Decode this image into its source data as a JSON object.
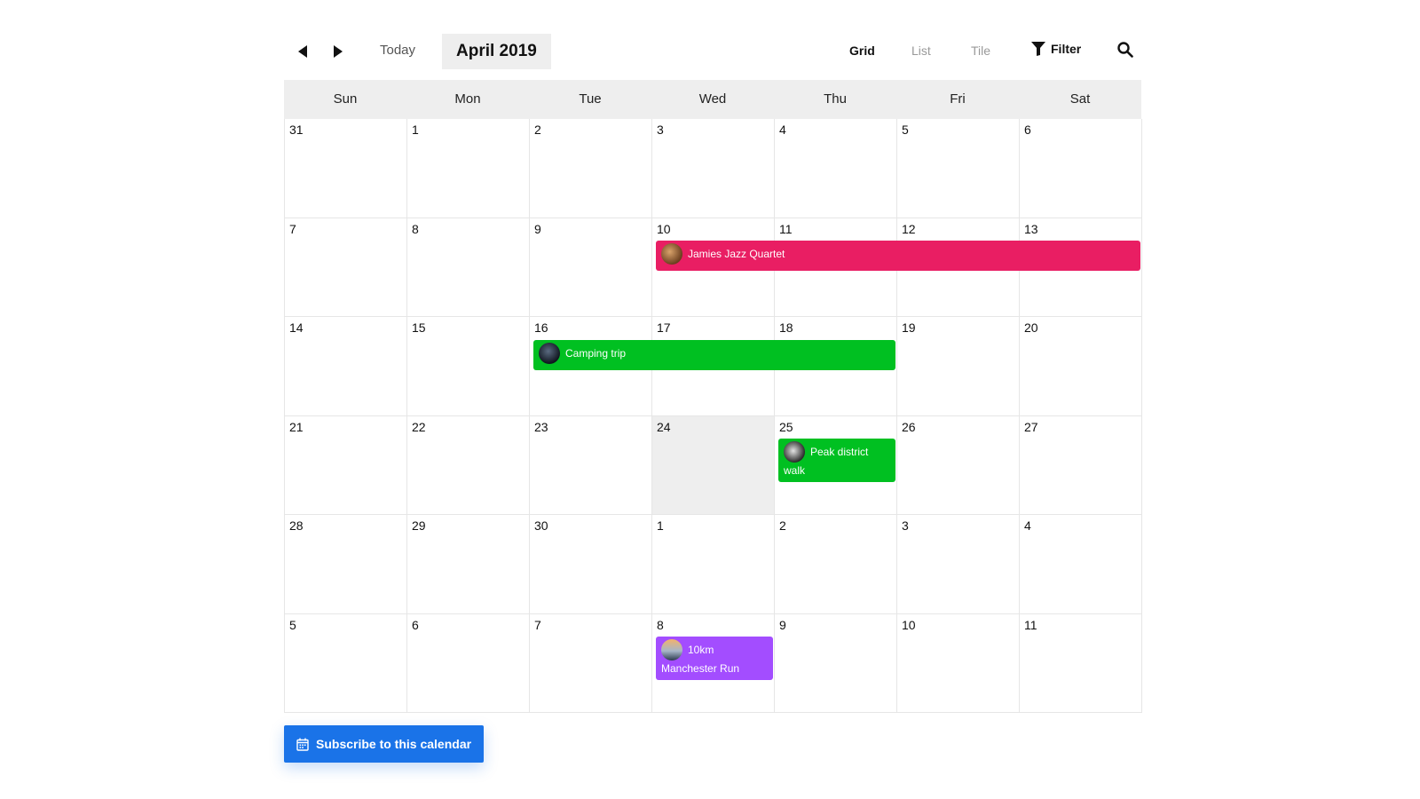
{
  "toolbar": {
    "today_label": "Today",
    "month_label": "April 2019",
    "views": {
      "grid": "Grid",
      "list": "List",
      "tile": "Tile"
    },
    "filter_label": "Filter",
    "icons": {
      "prev": "triangle-left-icon",
      "next": "triangle-right-icon",
      "filter": "funnel-icon",
      "search": "magnifier-icon"
    }
  },
  "weekdays": [
    "Sun",
    "Mon",
    "Tue",
    "Wed",
    "Thu",
    "Fri",
    "Sat"
  ],
  "weeks": [
    [
      "31",
      "1",
      "2",
      "3",
      "4",
      "5",
      "6"
    ],
    [
      "7",
      "8",
      "9",
      "10",
      "11",
      "12",
      "13"
    ],
    [
      "14",
      "15",
      "16",
      "17",
      "18",
      "19",
      "20"
    ],
    [
      "21",
      "22",
      "23",
      "24",
      "25",
      "26",
      "27"
    ],
    [
      "28",
      "29",
      "30",
      "1",
      "2",
      "3",
      "4"
    ],
    [
      "5",
      "6",
      "7",
      "8",
      "9",
      "10",
      "11"
    ]
  ],
  "events": {
    "jazz": {
      "title": "Jamies Jazz Quartet",
      "color": "#e91e63"
    },
    "camping": {
      "title": "Camping trip",
      "color": "#00c021"
    },
    "peak": {
      "title": "Peak district walk",
      "color": "#00c021"
    },
    "run": {
      "title": "10km Manchester Run",
      "color": "#a34dff"
    }
  },
  "subscribe": {
    "label": "Subscribe to this calendar",
    "icon": "calendar-icon",
    "color": "#1a73e8"
  },
  "colors": {
    "header_bg": "#eeeeee",
    "today_bg": "#eeeeee",
    "border": "#e6e6e6"
  }
}
